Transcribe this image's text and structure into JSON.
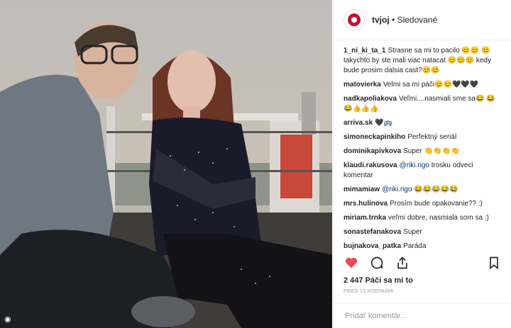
{
  "header": {
    "username": "tvjoj",
    "separator": "•",
    "follow_status": "Sledované"
  },
  "comments": [
    {
      "user": "1_ni_ki_ta_1",
      "text": "Strasne sa mi to pacilo 😊😊 😊 takychto by ste mali viac natacat 😊😊😊 kedy bude prosim dalsia cast?😊😊"
    },
    {
      "user": "matovierka",
      "text": "Velmi sa mi páči😊😊🖤🖤🖤"
    },
    {
      "user": "nadkapoliakova",
      "text": "Veľmi....nasmiali sme sa😂 😂😂👍👍👍"
    },
    {
      "user": "arriva.sk",
      "text": "🖤🚌"
    },
    {
      "user": "simoneckapinkiho",
      "text": "Perfektný seriál"
    },
    {
      "user": "dominikapivkova",
      "text": "Super 👏👏👏👏"
    },
    {
      "user": "klaudi.rakusova",
      "mention": "@riki.rigo",
      "text": "trosku odveci komentar"
    },
    {
      "user": "mimamiaw",
      "mention": "@riki.rigo",
      "text": "😂😂😂😂😂"
    },
    {
      "user": "mrs.hulinova",
      "text": "Prosím bude opakovanie?? :)"
    },
    {
      "user": "miriam.trnka",
      "text": "veľmi dobre, nasmiala som sa :)"
    },
    {
      "user": "sonastefanakova",
      "text": "Super"
    },
    {
      "user": "bujnakova_patka",
      "text": "Paráda"
    }
  ],
  "likes": "2 447 Páči sa mi to",
  "timestamp": "PRED 13 HODINAMI",
  "add_comment": {
    "placeholder": "Pridať komentár..."
  },
  "icons": {
    "like": "heart-icon",
    "comment": "comment-icon",
    "share": "share-icon",
    "save": "bookmark-icon",
    "tag": "person-tag-icon"
  },
  "colors": {
    "like": "#ed4956",
    "mention": "#003569",
    "brand": "#c8102e"
  }
}
